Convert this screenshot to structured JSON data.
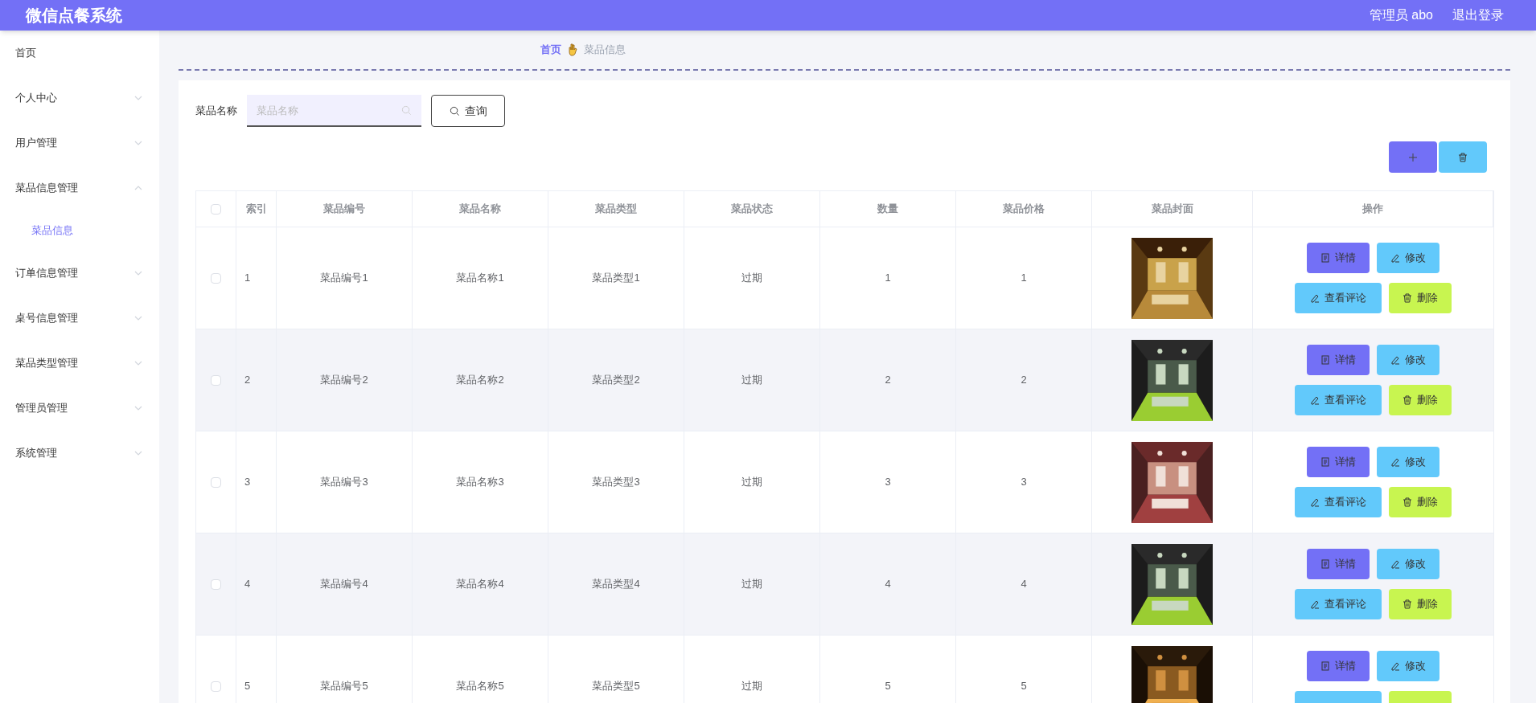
{
  "header": {
    "title": "微信点餐系统",
    "user": "管理员 abo",
    "logout": "退出登录"
  },
  "sidebar": {
    "items": [
      {
        "label": "首页"
      },
      {
        "label": "个人中心",
        "expanded": false
      },
      {
        "label": "用户管理",
        "expanded": false
      },
      {
        "label": "菜品信息管理",
        "expanded": true,
        "children": [
          {
            "label": "菜品信息",
            "selected": true
          }
        ]
      },
      {
        "label": "订单信息管理",
        "expanded": false
      },
      {
        "label": "桌号信息管理",
        "expanded": false
      },
      {
        "label": "菜品类型管理",
        "expanded": false
      },
      {
        "label": "管理员管理",
        "expanded": false
      },
      {
        "label": "系统管理",
        "expanded": false
      }
    ]
  },
  "breadcrumb": [
    "首页",
    "菜品信息"
  ],
  "search": {
    "label": "菜品名称",
    "placeholder": "菜品名称",
    "button": "查询"
  },
  "table": {
    "select_all": {
      "checked": false
    },
    "columns": [
      "索引",
      "菜品编号",
      "菜品名称",
      "菜品类型",
      "菜品状态",
      "数量",
      "菜品价格",
      "菜品封面",
      "操作"
    ],
    "rows": [
      {
        "checked": false,
        "cells": [
          "1",
          "菜品编号1",
          "菜品名称1",
          "菜品类型1",
          "过期",
          "1",
          "1"
        ],
        "actions": [
          "详情",
          "修改",
          "查看评论",
          "删除"
        ]
      },
      {
        "checked": false,
        "cells": [
          "2",
          "菜品编号2",
          "菜品名称2",
          "菜品类型2",
          "过期",
          "2",
          "2"
        ],
        "actions": [
          "详情",
          "修改",
          "查看评论",
          "删除"
        ]
      },
      {
        "checked": false,
        "cells": [
          "3",
          "菜品编号3",
          "菜品名称3",
          "菜品类型3",
          "过期",
          "3",
          "3"
        ],
        "actions": [
          "详情",
          "修改",
          "查看评论",
          "删除"
        ]
      },
      {
        "checked": false,
        "cells": [
          "4",
          "菜品编号4",
          "菜品名称4",
          "菜品类型4",
          "过期",
          "4",
          "4"
        ],
        "actions": [
          "详情",
          "修改",
          "查看评论",
          "删除"
        ]
      },
      {
        "checked": false,
        "cells": [
          "5",
          "菜品编号5",
          "菜品名称5",
          "菜品类型5",
          "过期",
          "5",
          "5"
        ],
        "actions": [
          "详情",
          "修改"
        ]
      }
    ]
  }
}
